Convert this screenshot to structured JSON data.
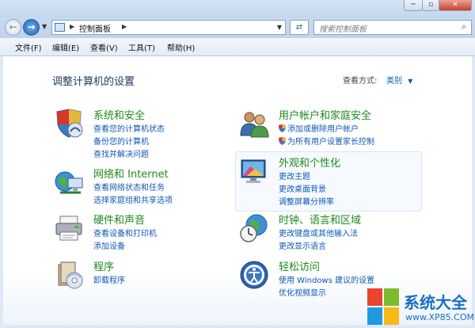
{
  "address": {
    "control_panel": "控制面板"
  },
  "search": {
    "placeholder": "搜索控制面板"
  },
  "menu": [
    "文件(F)",
    "编辑(E)",
    "查看(V)",
    "工具(T)",
    "帮助(H)"
  ],
  "main": {
    "title": "调整计算机的设置",
    "view_by_label": "查看方式:",
    "view_by_value": "类别"
  },
  "categories": [
    {
      "title": "系统和安全",
      "links": [
        "查看您的计算机状态",
        "备份您的计算机",
        "查找并解决问题"
      ],
      "icon": "system-security-icon"
    },
    {
      "title": "网络和 Internet",
      "links": [
        "查看网络状态和任务",
        "选择家庭组和共享选项"
      ],
      "icon": "network-icon"
    },
    {
      "title": "硬件和声音",
      "links": [
        "查看设备和打印机",
        "添加设备"
      ],
      "icon": "hardware-sound-icon"
    },
    {
      "title": "程序",
      "links": [
        "卸载程序"
      ],
      "icon": "programs-icon"
    },
    {
      "title": "用户帐户和家庭安全",
      "links": [
        "添加或删除用户帐户",
        "为所有用户设置家长控制"
      ],
      "icon": "user-accounts-icon"
    },
    {
      "title": "外观和个性化",
      "links": [
        "更改主题",
        "更改桌面背景",
        "调整屏幕分辨率"
      ],
      "icon": "appearance-icon"
    },
    {
      "title": "时钟、语言和区域",
      "links": [
        "更改键盘或其他输入法",
        "更改显示语言"
      ],
      "icon": "clock-language-icon"
    },
    {
      "title": "轻松访问",
      "links": [
        "使用 Windows 建议的设置",
        "优化视频显示"
      ],
      "icon": "ease-of-access-icon"
    }
  ],
  "watermark": {
    "name": "系统大全",
    "url": "www.XP85.COM"
  },
  "colors": {
    "category_title": "#1e8a1e",
    "link": "#0e58b4",
    "heading": "#1e395b"
  }
}
